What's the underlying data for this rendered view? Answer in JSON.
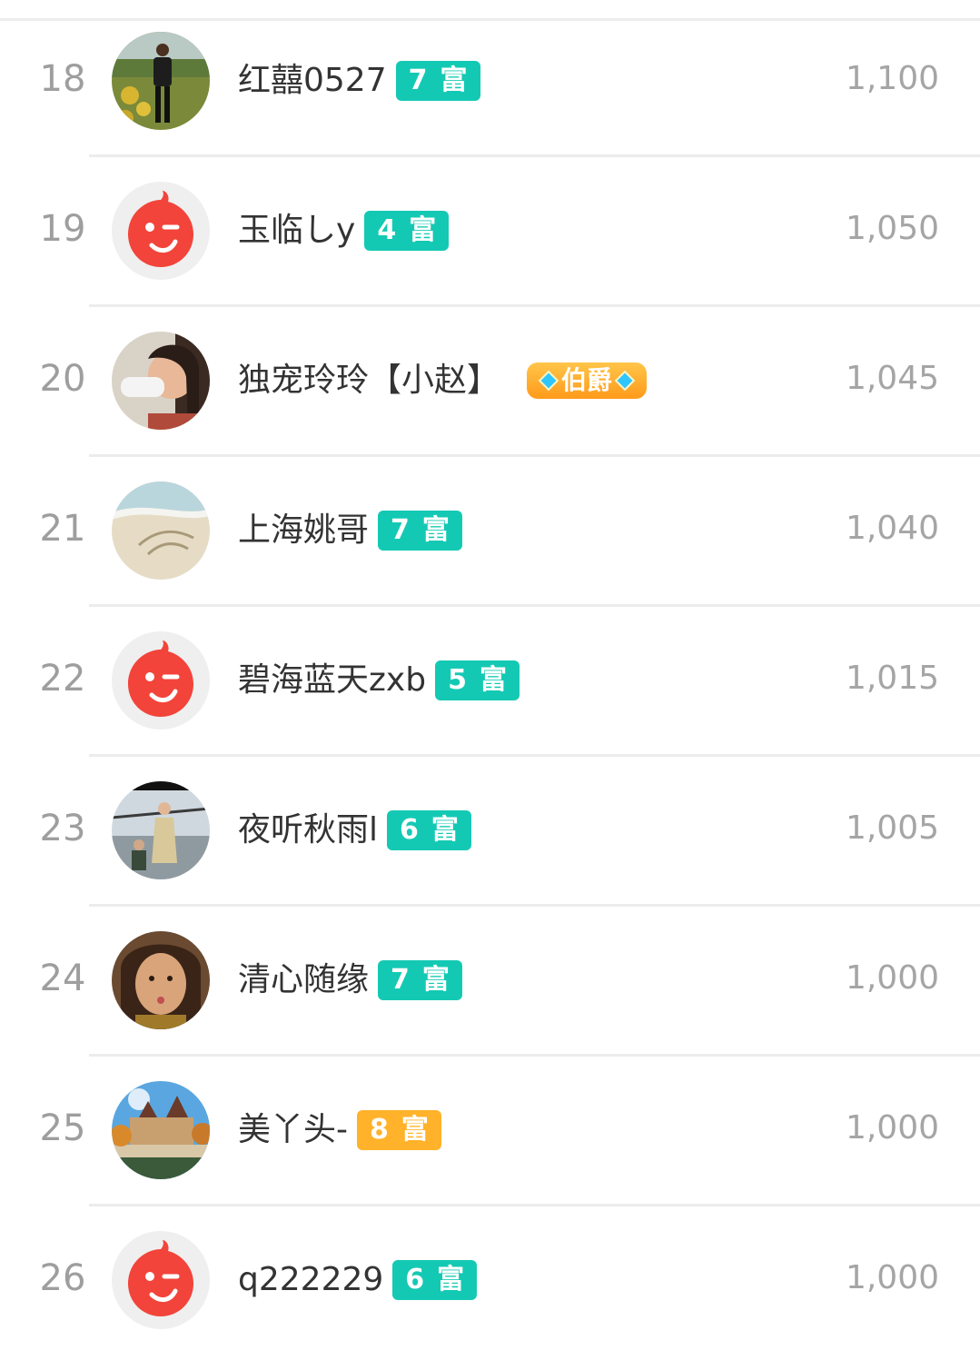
{
  "ranking": {
    "rows": [
      {
        "rank": "18",
        "name": "红囍0527",
        "badge_level": "7",
        "badge_text": "富",
        "badge_color": "#14c9b4",
        "score": "1,100",
        "avatar": "photo-man-walking"
      },
      {
        "rank": "19",
        "name": "玉临しy",
        "badge_level": "4",
        "badge_text": "富",
        "badge_color": "#14c9b4",
        "score": "1,050",
        "avatar": "default-red-mascot"
      },
      {
        "rank": "20",
        "name": "独宠玲玲【小赵】",
        "badge_level": "",
        "badge_text": "伯爵",
        "badge_color": "#ffb22a",
        "score": "1,045",
        "avatar": "photo-woman-drinking"
      },
      {
        "rank": "21",
        "name": "上海姚哥",
        "badge_level": "7",
        "badge_text": "富",
        "badge_color": "#14c9b4",
        "score": "1,040",
        "avatar": "photo-beach-sand"
      },
      {
        "rank": "22",
        "name": "碧海蓝天zxb",
        "badge_level": "5",
        "badge_text": "富",
        "badge_color": "#14c9b4",
        "score": "1,015",
        "avatar": "default-red-mascot"
      },
      {
        "rank": "23",
        "name": "夜听秋雨l",
        "badge_level": "6",
        "badge_text": "富",
        "badge_color": "#14c9b4",
        "score": "1,005",
        "avatar": "photo-woman-lake"
      },
      {
        "rank": "24",
        "name": "清心随缘",
        "badge_level": "7",
        "badge_text": "富",
        "badge_color": "#14c9b4",
        "score": "1,000",
        "avatar": "photo-woman-portrait"
      },
      {
        "rank": "25",
        "name": "美丫头-",
        "badge_level": "8",
        "badge_text": "富",
        "badge_color": "#ffb22a",
        "score": "1,000",
        "avatar": "photo-castle-bridge"
      },
      {
        "rank": "26",
        "name": "q222229",
        "badge_level": "6",
        "badge_text": "富",
        "badge_color": "#14c9b4",
        "score": "1,000",
        "avatar": "default-red-mascot"
      }
    ]
  }
}
